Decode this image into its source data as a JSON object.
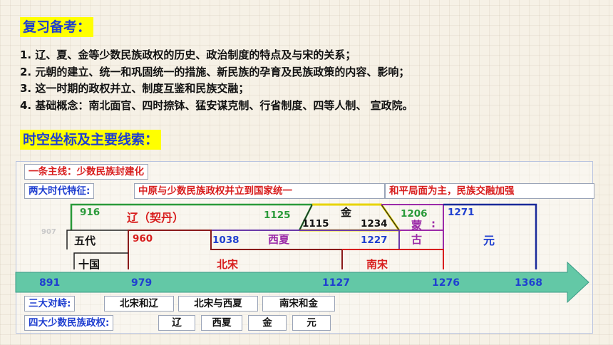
{
  "headings": {
    "review": "复习备考：",
    "timeline": "时空坐标及主要线索："
  },
  "review_items": [
    "1. 辽、夏、金等少数民族政权的历史、政治制度的特点及与宋的关系；",
    "2. 元朝的建立、统一和巩固统一的措施、新民族的孕育及民族政策的内容、影响；",
    "3. 这一时期的政权并立、制度互鉴和民族交融；",
    "4. 基础概念：南北面官、四时捺钵、猛安谋克制、行省制度、四等人制、 宣政院。"
  ],
  "main_line": "一条主线：少数民族封建化",
  "features": {
    "label": "两大时代特征:",
    "items": [
      "中原与少数民族政权并立到国家统一",
      "和平局面为主，民族交融加强"
    ]
  },
  "regimes": {
    "liao": "辽（契丹）",
    "jin": "金",
    "xixia": "西夏",
    "wudai": "五代",
    "shiguo": "十国",
    "beisong": "北宋",
    "nansong": "南宋",
    "menggu_1": "蒙",
    "menggu_sep": ":",
    "menggu_2": "古",
    "yuan": "元"
  },
  "years": {
    "y916": "916",
    "y1125": "1125",
    "y1115": "1115",
    "y1234": "1234",
    "y1206": "1206",
    "y1271": "1271",
    "y960": "960",
    "y1038": "1038",
    "y1227": "1227",
    "y907": "907"
  },
  "axis_ticks": [
    "891",
    "979",
    "1127",
    "1276",
    "1368"
  ],
  "confrontations": {
    "label": "三大对峙:",
    "items": [
      "北宋和辽",
      "北宋与西夏",
      "南宋和金"
    ]
  },
  "minorities": {
    "label": "四大少数民族政权:",
    "items": [
      "辽",
      "西夏",
      "金",
      "元"
    ]
  },
  "colors": {
    "heading_blue": "#1f3fd0",
    "highlight_yellow": "#ffff00",
    "liao_green": "#2a9a3a",
    "song_red": "#d81e1e",
    "mongol_purple": "#9b2aa8",
    "jin_yellow": "#e8d400",
    "arrow_teal": "#63c8a6"
  }
}
